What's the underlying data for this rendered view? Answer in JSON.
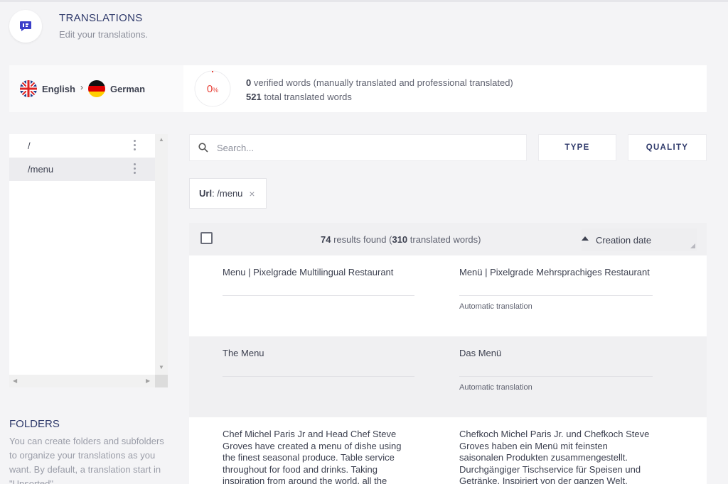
{
  "header": {
    "title": "TRANSLATIONS",
    "subtitle": "Edit your translations.",
    "icon": "translate-icon"
  },
  "languages": {
    "source": "English",
    "target": "German",
    "source_flag": "uk-flag-icon",
    "target_flag": "germany-flag-icon"
  },
  "progress": {
    "value": "0",
    "unit": "%",
    "fraction": 0,
    "color": "#e8453c"
  },
  "stats": {
    "verified_count": "0",
    "verified_label": " verified words (manually translated and professional translated)",
    "total_count": "521",
    "total_label": " total translated words"
  },
  "folders_tree": {
    "items": [
      {
        "label": "/"
      },
      {
        "label": "/menu",
        "active": true
      }
    ]
  },
  "folders_help": {
    "title": "FOLDERS",
    "text": "You can create folders and subfolders to organize your translations as you want. By default, a translation start in \"Unsorted\""
  },
  "search": {
    "placeholder": "Search...",
    "value": ""
  },
  "filters": {
    "type_label": "TYPE",
    "quality_label": "QUALITY"
  },
  "active_filter": {
    "key": "Url",
    "value": ": /menu",
    "close": "×"
  },
  "results": {
    "count": "74",
    "count_label": " results found (",
    "words": "310",
    "words_label": " translated words)",
    "sort_label": "Creation date"
  },
  "rows": [
    {
      "source": "Menu | Pixelgrade Multilingual Restaurant",
      "target": "Menü | Pixelgrade Mehrsprachiges Restaurant",
      "meta": "Automatic translation"
    },
    {
      "source": "The Menu",
      "target": "Das Menü",
      "meta": "Automatic translation"
    },
    {
      "source": "Chef Michel Paris Jr and Head Chef Steve Groves have created a menu of dishe using the finest seasonal produce. Table service throughout for food and drinks. Taking inspiration from around the world, all the",
      "target": "Chefkoch Michel Paris Jr. und Chefkoch Steve Groves haben ein Menü mit feinsten saisonalen Produkten zusammengestellt. Durchgängiger Tischservice für Speisen und Getränke. Inspiriert von der ganzen Welt,",
      "meta": ""
    }
  ],
  "colors": {
    "accent": "#2f3a6b",
    "icon": "#3b3fc9",
    "background": "#f4f4f6"
  }
}
